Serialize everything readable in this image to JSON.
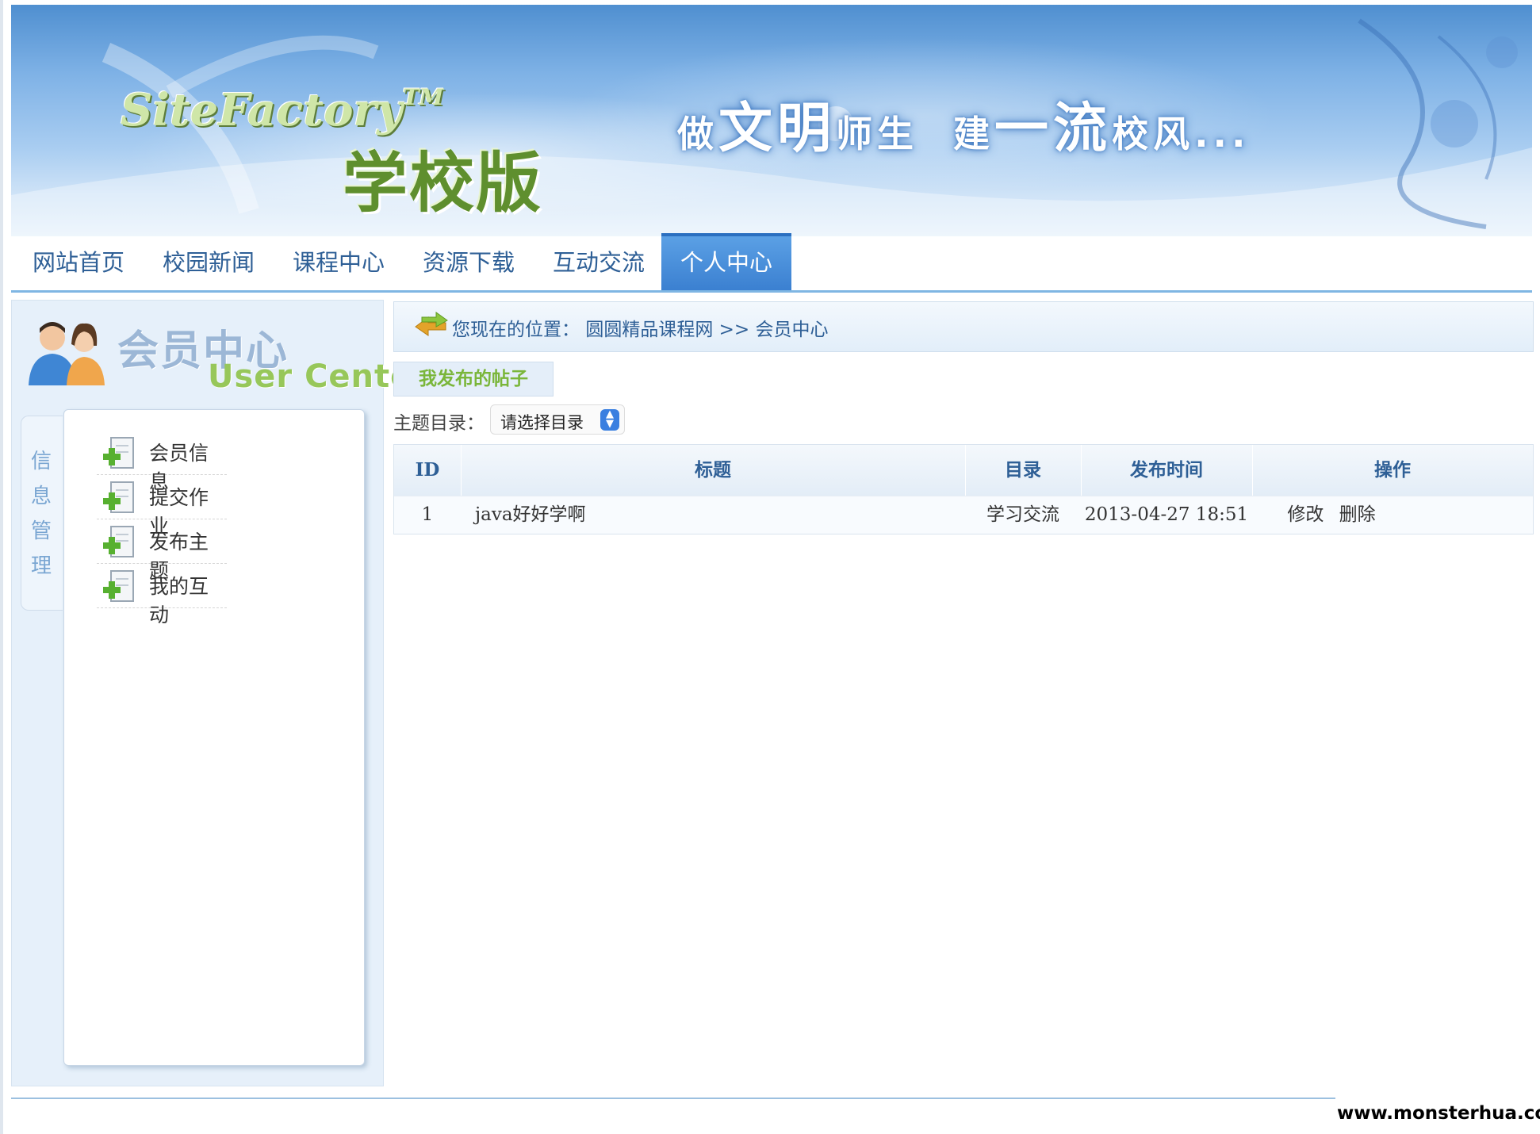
{
  "banner": {
    "logo_en": "SiteFactory",
    "logo_tm": "TM",
    "logo_cn": "学校版",
    "slogan_1": "做",
    "slogan_2": "文明",
    "slogan_3": "师生",
    "slogan_4": "建",
    "slogan_5": "一流",
    "slogan_6": "校风..."
  },
  "nav": {
    "items": [
      "网站首页",
      "校园新闻",
      "课程中心",
      "资源下载",
      "互动交流",
      "个人中心"
    ],
    "active_index": 5
  },
  "user_center": {
    "title_cn": "会员中心",
    "title_en": "User Center",
    "side_tab": [
      "信",
      "息",
      "管",
      "理"
    ],
    "menu": [
      "会员信息",
      "提交作业",
      "发布主题",
      "我的互动"
    ]
  },
  "breadcrumb": {
    "prefix": "您现在的位置：",
    "site": "圆圆精品课程网",
    "separator": ">>",
    "current": "会员中心"
  },
  "tab": {
    "label": "我发布的帖子"
  },
  "filter": {
    "label": "主题目录：",
    "selected": "请选择目录"
  },
  "table": {
    "headers": [
      "ID",
      "标题",
      "目录",
      "发布时间",
      "操作"
    ],
    "rows": [
      {
        "id": "1",
        "title": "java好好学啊",
        "category": "学习交流",
        "time": "2013-04-27 18:51",
        "edit": "修改",
        "delete": "删除"
      }
    ]
  },
  "watermark": "www.monsterhua.com",
  "colors": {
    "nav_text": "#2e5f96",
    "nav_active_bg": "#3a7fd0",
    "tab_text": "#7ab63a",
    "panel_bg": "#e6f0fa"
  }
}
